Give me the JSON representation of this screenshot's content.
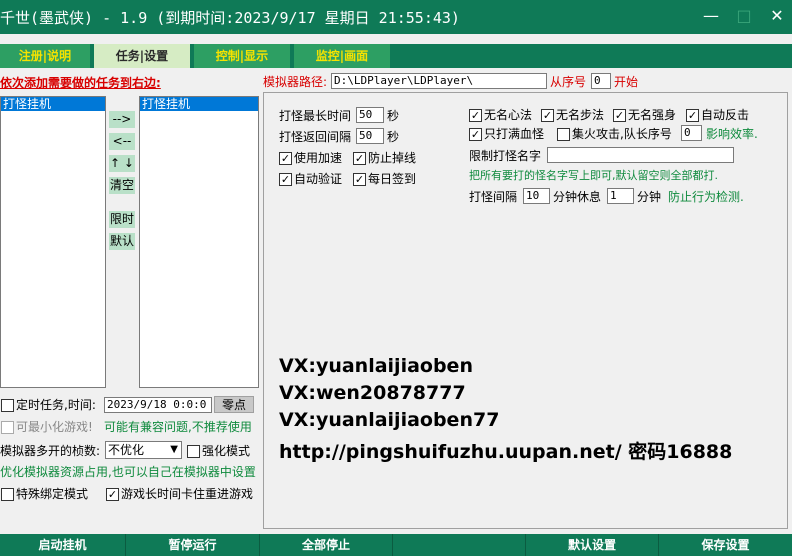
{
  "window": {
    "title": "千世(墨武侠) - 1.9 (到期时间:2023/9/17 星期日 21:55:43)",
    "minimize": "—",
    "maximize": "□",
    "close": "✕"
  },
  "tabs": [
    {
      "label": "注册|说明"
    },
    {
      "label": "任务|设置"
    },
    {
      "label": "控制|显示"
    },
    {
      "label": "监控|画面"
    }
  ],
  "left": {
    "instruction": "依次添加需要做的任务到右边:",
    "available_list": [
      "打怪挂机"
    ],
    "selected_list": [
      "打怪挂机"
    ],
    "buttons": {
      "add": "-->",
      "remove": "<--",
      "updown": "↑ ↓",
      "clear": "清空",
      "limit": "限时",
      "default": "默认"
    },
    "timer_task_label": "定时任务,时间:",
    "timer_task_checked": false,
    "timer_value": "2023/9/18 0:0:0",
    "zero_button": "零点",
    "minimize_game_label": "可最小化游戏!",
    "minimize_game_checked": false,
    "compat_note": "可能有兼容问题,不推荐使用",
    "emu_fps_label": "模拟器多开的桢数:",
    "emu_fps_value": "不优化",
    "enhance_label": "强化模式",
    "enhance_checked": false,
    "optimize_note": "优化模拟器资源占用,也可以自己在模拟器中设置",
    "special_bind_label": "特殊绑定模式",
    "special_bind_checked": false,
    "stuck_label": "游戏长时间卡住重进游戏",
    "stuck_checked": true
  },
  "emulator": {
    "path_label": "模拟器路径:",
    "path_value": "D:\\LDPlayer\\LDPlayer\\",
    "from_index_label": "从序号",
    "from_index_value": "0",
    "start_label": "开始"
  },
  "settings": {
    "max_time_label": "打怪最长时间",
    "max_time_value": "50",
    "max_time_unit": "秒",
    "return_interval_label": "打怪返回间隔",
    "return_interval_value": "50",
    "return_interval_unit": "秒",
    "use_accel_label": "使用加速",
    "use_accel_checked": true,
    "anti_drop_label": "防止掉线",
    "anti_drop_checked": true,
    "auto_verify_label": "自动验证",
    "auto_verify_checked": true,
    "daily_signin_label": "每日签到",
    "daily_signin_checked": true,
    "skill1_label": "无名心法",
    "skill1_checked": true,
    "skill2_label": "无名步法",
    "skill2_checked": true,
    "skill3_label": "无名强身",
    "skill3_checked": true,
    "counter_label": "自动反击",
    "counter_checked": true,
    "full_hp_label": "只打满血怪",
    "full_hp_checked": true,
    "focus_attack_label": "集火攻击,队长序号",
    "focus_attack_checked": false,
    "leader_index_value": "0",
    "efficiency_note": "影响效率.",
    "limit_name_label": "限制打怪名字",
    "limit_name_value": "",
    "limit_name_note": "把所有要打的怪名字写上即可,默认留空则全部都打.",
    "interval_label": "打怪间隔",
    "interval_value": "10",
    "rest_label": "分钟休息",
    "rest_value": "1",
    "rest_unit": "分钟",
    "detect_note": "防止行为检测."
  },
  "contact": {
    "line1": "VX:yuanlaijiaoben",
    "line2": "VX:wen20878777",
    "line3": "VX:yuanlaijiaoben77",
    "line4": "http://pingshuifuzhu.uupan.net/ 密码16888"
  },
  "bottom_buttons": [
    {
      "label": "启动挂机"
    },
    {
      "label": "暂停运行"
    },
    {
      "label": "全部停止"
    },
    {
      "label": ""
    },
    {
      "label": "默认设置"
    },
    {
      "label": "保存设置"
    }
  ],
  "colors": {
    "brand_green": "#0f7a57",
    "tab_active_bg": "#d6ecc4",
    "tab_text_yellow": "#f5e200",
    "note_green": "#0f8a3d",
    "label_red": "#d80000",
    "selection_blue": "#0078d7"
  }
}
